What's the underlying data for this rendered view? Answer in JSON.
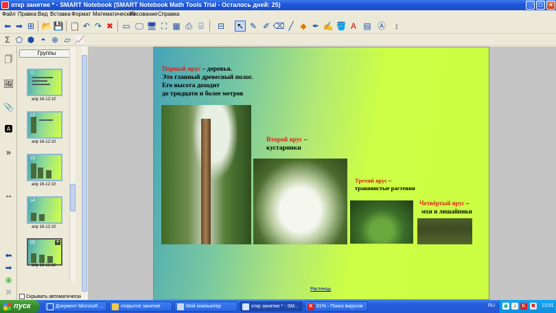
{
  "window": {
    "title": "откр занятие * - SMART Notebook (SMART Notebook Math Tools Trial - Осталось дней: 25)"
  },
  "menu": [
    "Файл",
    "Правка",
    "Вид",
    "Вставка",
    "Формат",
    "Математический",
    "Рисование",
    "Справка"
  ],
  "sorter": {
    "groups_label": "Группы",
    "thumbs": [
      {
        "number": "11",
        "date": "апр 16-12:10"
      },
      {
        "number": "12",
        "date": "апр 16-12:10"
      },
      {
        "number": "13",
        "date": "апр 16-12:10"
      },
      {
        "number": "14",
        "date": "апр 16-12:10"
      },
      {
        "number": "15",
        "date": "апр 16-12:10"
      }
    ],
    "autohide_label": "Скрывать автоматически"
  },
  "slide": {
    "tier1": {
      "title": "Первый ярус",
      "rest": " – деревья.",
      "lines": [
        "Это главный древесный полог.",
        "Его высота доходит",
        "до тридцати и более метров"
      ]
    },
    "tier2": {
      "title": "Второй ярус",
      "rest": " –",
      "line2": "кустарники"
    },
    "tier3": {
      "title": "Третий ярус",
      "rest": " –",
      "line2": "травянистые растения"
    },
    "tier4": {
      "title": "Четвёртый ярус",
      "rest": " –",
      "line2": "мхи и лишайники"
    },
    "link": "Растенць"
  },
  "taskbar": {
    "start": "пуск",
    "tasks": [
      {
        "label": "Документ Microsoft ..."
      },
      {
        "label": "открытое занятие"
      },
      {
        "label": "Мой компьютер"
      },
      {
        "label": "откр занятие * - SM..."
      },
      {
        "label": "81% - Поиск вирусов"
      }
    ],
    "lang": "RU",
    "clock": "13:01"
  },
  "colors": {
    "accent_red": "#e21b1b",
    "title_blue": "#1d55d6"
  }
}
